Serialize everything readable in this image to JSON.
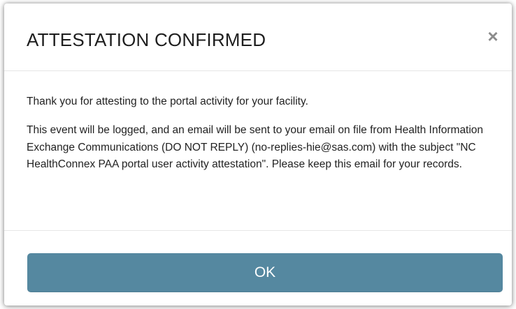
{
  "dialog": {
    "title": "ATTESTATION CONFIRMED",
    "close_glyph": "×",
    "close_icon": "close-icon",
    "paragraph_1": "Thank you for attesting to the portal activity for your facility.",
    "paragraph_2": "This event will be logged, and an email will be sent to your email on file from Health Information Exchange Communications (DO NOT REPLY) (no-replies-hie@sas.com) with the subject \"NC HealthConnex PAA portal user activity attestation\". Please keep this email for your records.",
    "ok_label": "OK"
  },
  "colors": {
    "button_bg": "#5588a0",
    "button_text": "#ffffff",
    "title_text": "#1e1e1e",
    "close_icon": "#8c8c8c",
    "divider": "#e6e6e6"
  }
}
